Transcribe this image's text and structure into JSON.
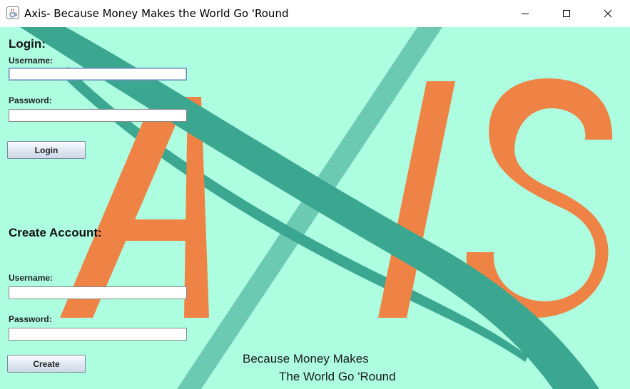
{
  "window": {
    "title": "Axis- Because Money Makes the World Go 'Round",
    "icon": "java-cup-icon",
    "controls": [
      "minimize-icon",
      "maximize-icon",
      "close-icon"
    ]
  },
  "logo": {
    "text": "AXIS",
    "colors": {
      "letters": "#ef8345",
      "ring_dark": "#3ca790",
      "ring_light": "#6dcab2",
      "background": "#adfde0"
    }
  },
  "login": {
    "heading": "Login:",
    "username_label": "Username:",
    "username_value": "",
    "password_label": "Password:",
    "password_value": "",
    "button_label": "Login"
  },
  "create": {
    "heading": "Create Account:",
    "username_label": "Username:",
    "username_value": "",
    "password_label": "Password:",
    "password_value": "",
    "button_label": "Create"
  },
  "tagline": {
    "line1": "Because Money Makes",
    "line2": "The World Go 'Round"
  }
}
